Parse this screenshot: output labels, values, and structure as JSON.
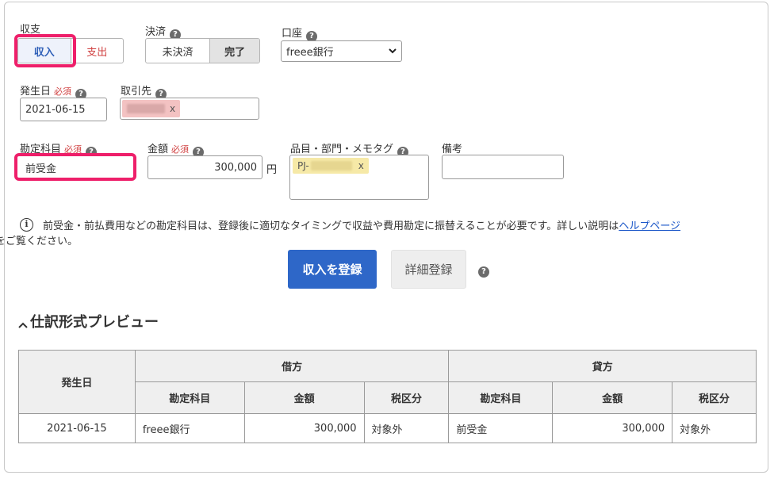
{
  "form": {
    "income_expense": {
      "label": "収支",
      "options": [
        "収入",
        "支出"
      ],
      "selected": "収入"
    },
    "settlement": {
      "label": "決済",
      "options": [
        "未決済",
        "完了"
      ],
      "selected": "完了"
    },
    "account": {
      "label": "口座",
      "value": "freee銀行"
    },
    "date": {
      "label": "発生日",
      "required": "必須",
      "value": "2021-06-15"
    },
    "partner": {
      "label": "取引先",
      "remove": "x"
    },
    "category": {
      "label": "勘定科目",
      "required": "必須",
      "value": "前受金"
    },
    "amount": {
      "label": "金額",
      "required": "必須",
      "value": "300,000",
      "unit": "円"
    },
    "tags": {
      "label": "品目・部門・メモタグ",
      "tag_prefix": "PJ-",
      "remove": "x"
    },
    "memo": {
      "label": "備考",
      "value": ""
    },
    "help_mark": "?"
  },
  "notice": {
    "icon": "i",
    "text": "前受金・前払費用などの勘定科目は、登録後に適切なタイミングで収益や費用勘定に振替えることが必要です。詳しい説明は",
    "link": "ヘルプページ",
    "suffix": "をご覧ください。"
  },
  "actions": {
    "primary": "収入を登録",
    "secondary": "詳細登録"
  },
  "preview": {
    "title": "仕訳形式プレビュー",
    "headers": {
      "date": "発生日",
      "debit": "借方",
      "credit": "貸方",
      "account": "勘定科目",
      "amount": "金額",
      "tax": "税区分"
    },
    "row": {
      "date": "2021-06-15",
      "debit_account": "freee銀行",
      "debit_amount": "300,000",
      "debit_tax": "対象外",
      "credit_account": "前受金",
      "credit_amount": "300,000",
      "credit_tax": "対象外"
    }
  },
  "colors": {
    "highlight": "#ee1f6a",
    "primary": "#2e67c8",
    "income": "#2e5fb8",
    "expense": "#d04040"
  }
}
